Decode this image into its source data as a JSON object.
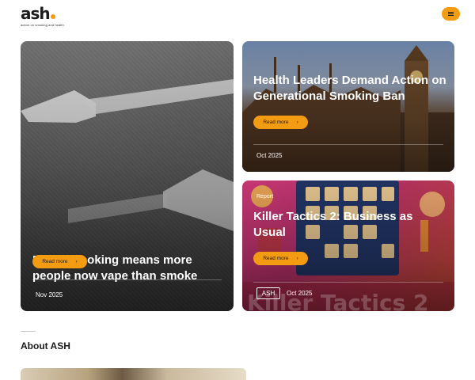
{
  "header": {
    "logo_text": "ash",
    "logo_tagline": "action on smoking and health",
    "menu_button": "menu",
    "icons": {
      "menu": "hamburger-icon",
      "read_more": "chevron-right-icon"
    },
    "colors": {
      "accent": "#f39c12",
      "text": "#1a1a1a",
      "background": "#ffffff"
    }
  },
  "cards": {
    "featured": {
      "title": "Fall in smoking means more people now vape than smoke",
      "button": "Read more",
      "date": "Nov 2025"
    },
    "top_right": {
      "title": "Health Leaders Demand Action on Generational Smoking Ban",
      "button": "Read more",
      "date": "Oct 2025"
    },
    "bottom_right": {
      "category": "Report",
      "title": "Killer Tactics 2: Business as Usual",
      "button": "Read more",
      "badge": "ASH",
      "date": "Oct 2025",
      "image_text": "Killer Tactics 2"
    }
  },
  "about": {
    "heading": "About ASH"
  }
}
